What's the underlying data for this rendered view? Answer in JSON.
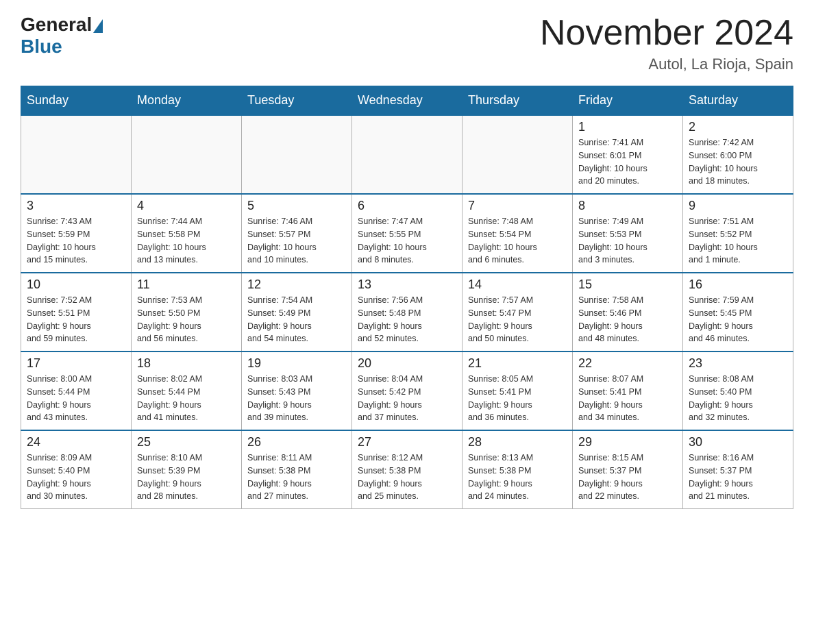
{
  "header": {
    "logo_general": "General",
    "logo_blue": "Blue",
    "month_year": "November 2024",
    "location": "Autol, La Rioja, Spain"
  },
  "weekdays": [
    "Sunday",
    "Monday",
    "Tuesday",
    "Wednesday",
    "Thursday",
    "Friday",
    "Saturday"
  ],
  "weeks": [
    [
      {
        "day": "",
        "info": ""
      },
      {
        "day": "",
        "info": ""
      },
      {
        "day": "",
        "info": ""
      },
      {
        "day": "",
        "info": ""
      },
      {
        "day": "",
        "info": ""
      },
      {
        "day": "1",
        "info": "Sunrise: 7:41 AM\nSunset: 6:01 PM\nDaylight: 10 hours\nand 20 minutes."
      },
      {
        "day": "2",
        "info": "Sunrise: 7:42 AM\nSunset: 6:00 PM\nDaylight: 10 hours\nand 18 minutes."
      }
    ],
    [
      {
        "day": "3",
        "info": "Sunrise: 7:43 AM\nSunset: 5:59 PM\nDaylight: 10 hours\nand 15 minutes."
      },
      {
        "day": "4",
        "info": "Sunrise: 7:44 AM\nSunset: 5:58 PM\nDaylight: 10 hours\nand 13 minutes."
      },
      {
        "day": "5",
        "info": "Sunrise: 7:46 AM\nSunset: 5:57 PM\nDaylight: 10 hours\nand 10 minutes."
      },
      {
        "day": "6",
        "info": "Sunrise: 7:47 AM\nSunset: 5:55 PM\nDaylight: 10 hours\nand 8 minutes."
      },
      {
        "day": "7",
        "info": "Sunrise: 7:48 AM\nSunset: 5:54 PM\nDaylight: 10 hours\nand 6 minutes."
      },
      {
        "day": "8",
        "info": "Sunrise: 7:49 AM\nSunset: 5:53 PM\nDaylight: 10 hours\nand 3 minutes."
      },
      {
        "day": "9",
        "info": "Sunrise: 7:51 AM\nSunset: 5:52 PM\nDaylight: 10 hours\nand 1 minute."
      }
    ],
    [
      {
        "day": "10",
        "info": "Sunrise: 7:52 AM\nSunset: 5:51 PM\nDaylight: 9 hours\nand 59 minutes."
      },
      {
        "day": "11",
        "info": "Sunrise: 7:53 AM\nSunset: 5:50 PM\nDaylight: 9 hours\nand 56 minutes."
      },
      {
        "day": "12",
        "info": "Sunrise: 7:54 AM\nSunset: 5:49 PM\nDaylight: 9 hours\nand 54 minutes."
      },
      {
        "day": "13",
        "info": "Sunrise: 7:56 AM\nSunset: 5:48 PM\nDaylight: 9 hours\nand 52 minutes."
      },
      {
        "day": "14",
        "info": "Sunrise: 7:57 AM\nSunset: 5:47 PM\nDaylight: 9 hours\nand 50 minutes."
      },
      {
        "day": "15",
        "info": "Sunrise: 7:58 AM\nSunset: 5:46 PM\nDaylight: 9 hours\nand 48 minutes."
      },
      {
        "day": "16",
        "info": "Sunrise: 7:59 AM\nSunset: 5:45 PM\nDaylight: 9 hours\nand 46 minutes."
      }
    ],
    [
      {
        "day": "17",
        "info": "Sunrise: 8:00 AM\nSunset: 5:44 PM\nDaylight: 9 hours\nand 43 minutes."
      },
      {
        "day": "18",
        "info": "Sunrise: 8:02 AM\nSunset: 5:44 PM\nDaylight: 9 hours\nand 41 minutes."
      },
      {
        "day": "19",
        "info": "Sunrise: 8:03 AM\nSunset: 5:43 PM\nDaylight: 9 hours\nand 39 minutes."
      },
      {
        "day": "20",
        "info": "Sunrise: 8:04 AM\nSunset: 5:42 PM\nDaylight: 9 hours\nand 37 minutes."
      },
      {
        "day": "21",
        "info": "Sunrise: 8:05 AM\nSunset: 5:41 PM\nDaylight: 9 hours\nand 36 minutes."
      },
      {
        "day": "22",
        "info": "Sunrise: 8:07 AM\nSunset: 5:41 PM\nDaylight: 9 hours\nand 34 minutes."
      },
      {
        "day": "23",
        "info": "Sunrise: 8:08 AM\nSunset: 5:40 PM\nDaylight: 9 hours\nand 32 minutes."
      }
    ],
    [
      {
        "day": "24",
        "info": "Sunrise: 8:09 AM\nSunset: 5:40 PM\nDaylight: 9 hours\nand 30 minutes."
      },
      {
        "day": "25",
        "info": "Sunrise: 8:10 AM\nSunset: 5:39 PM\nDaylight: 9 hours\nand 28 minutes."
      },
      {
        "day": "26",
        "info": "Sunrise: 8:11 AM\nSunset: 5:38 PM\nDaylight: 9 hours\nand 27 minutes."
      },
      {
        "day": "27",
        "info": "Sunrise: 8:12 AM\nSunset: 5:38 PM\nDaylight: 9 hours\nand 25 minutes."
      },
      {
        "day": "28",
        "info": "Sunrise: 8:13 AM\nSunset: 5:38 PM\nDaylight: 9 hours\nand 24 minutes."
      },
      {
        "day": "29",
        "info": "Sunrise: 8:15 AM\nSunset: 5:37 PM\nDaylight: 9 hours\nand 22 minutes."
      },
      {
        "day": "30",
        "info": "Sunrise: 8:16 AM\nSunset: 5:37 PM\nDaylight: 9 hours\nand 21 minutes."
      }
    ]
  ]
}
